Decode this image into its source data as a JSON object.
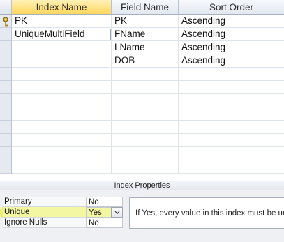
{
  "columns": {
    "index_name": "Index Name",
    "field_name": "Field Name",
    "sort_order": "Sort Order"
  },
  "rows": [
    {
      "index_name": "PK",
      "field_name": "PK",
      "sort_order": "Ascending",
      "primary_key": true
    },
    {
      "index_name": "UniqueMultiField",
      "field_name": "FName",
      "sort_order": "Ascending"
    },
    {
      "index_name": "",
      "field_name": "LName",
      "sort_order": "Ascending"
    },
    {
      "index_name": "",
      "field_name": "DOB",
      "sort_order": "Ascending"
    }
  ],
  "properties": {
    "title": "Index Properties",
    "items": [
      {
        "label": "Primary",
        "value": "No"
      },
      {
        "label": "Unique",
        "value": "Yes",
        "selected": true
      },
      {
        "label": "Ignore Nulls",
        "value": "No"
      }
    ],
    "help_text": "If Yes, every value in this index must be unique."
  },
  "colors": {
    "header_active": "#ffd65c",
    "highlight": "#e8f200"
  },
  "icons": {
    "primary_key": "key-icon",
    "dropdown": "chevron-down-icon"
  }
}
